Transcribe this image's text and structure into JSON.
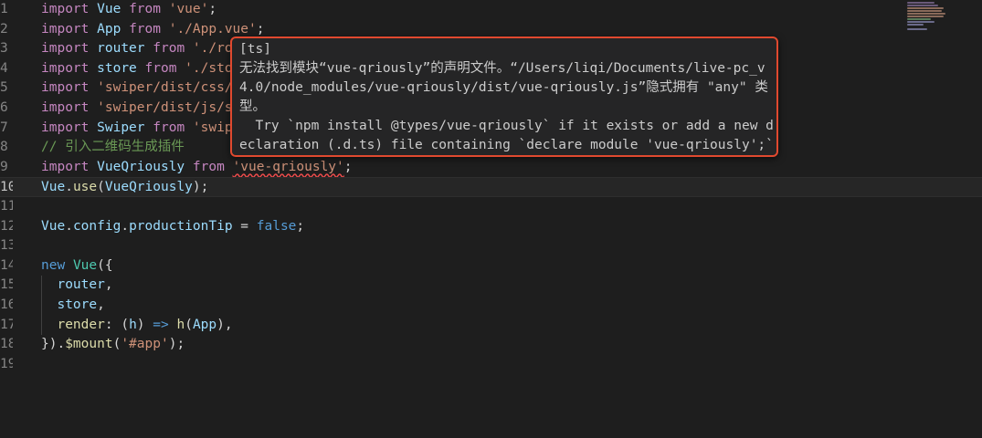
{
  "editor": {
    "lines": [
      {
        "num": "1",
        "tokens": [
          {
            "t": "import",
            "c": "kw2"
          },
          {
            "t": " "
          },
          {
            "t": "Vue",
            "c": "id"
          },
          {
            "t": " "
          },
          {
            "t": "from",
            "c": "kw2"
          },
          {
            "t": " "
          },
          {
            "t": "'vue'",
            "c": "str"
          },
          {
            "t": ";"
          }
        ]
      },
      {
        "num": "2",
        "tokens": [
          {
            "t": "import",
            "c": "kw2"
          },
          {
            "t": " "
          },
          {
            "t": "App",
            "c": "id"
          },
          {
            "t": " "
          },
          {
            "t": "from",
            "c": "kw2"
          },
          {
            "t": " "
          },
          {
            "t": "'./App.vue'",
            "c": "str"
          },
          {
            "t": ";"
          }
        ]
      },
      {
        "num": "3",
        "tokens": [
          {
            "t": "import",
            "c": "kw2"
          },
          {
            "t": " "
          },
          {
            "t": "router",
            "c": "id"
          },
          {
            "t": " "
          },
          {
            "t": "from",
            "c": "kw2"
          },
          {
            "t": " "
          },
          {
            "t": "'./ro",
            "c": "str"
          }
        ]
      },
      {
        "num": "4",
        "tokens": [
          {
            "t": "import",
            "c": "kw2"
          },
          {
            "t": " "
          },
          {
            "t": "store",
            "c": "id"
          },
          {
            "t": " "
          },
          {
            "t": "from",
            "c": "kw2"
          },
          {
            "t": " "
          },
          {
            "t": "'./sto",
            "c": "str"
          }
        ]
      },
      {
        "num": "5",
        "tokens": [
          {
            "t": "import",
            "c": "kw2"
          },
          {
            "t": " "
          },
          {
            "t": "'swiper/dist/css/",
            "c": "str"
          }
        ]
      },
      {
        "num": "6",
        "tokens": [
          {
            "t": "import",
            "c": "kw2"
          },
          {
            "t": " "
          },
          {
            "t": "'swiper/dist/js/s",
            "c": "str"
          }
        ]
      },
      {
        "num": "7",
        "tokens": [
          {
            "t": "import",
            "c": "kw2"
          },
          {
            "t": " "
          },
          {
            "t": "Swiper",
            "c": "id"
          },
          {
            "t": " "
          },
          {
            "t": "from",
            "c": "kw2"
          },
          {
            "t": " "
          },
          {
            "t": "'swip",
            "c": "str"
          }
        ]
      },
      {
        "num": "8",
        "tokens": [
          {
            "t": "// 引入二维码生成插件",
            "c": "cmt"
          }
        ]
      },
      {
        "num": "9",
        "tokens": [
          {
            "t": "import",
            "c": "kw2"
          },
          {
            "t": " "
          },
          {
            "t": "VueQriously",
            "c": "id"
          },
          {
            "t": " "
          },
          {
            "t": "from",
            "c": "kw2"
          },
          {
            "t": " "
          },
          {
            "t": "'vue-qriously'",
            "c": "str squiggle"
          },
          {
            "t": ";"
          }
        ]
      },
      {
        "num": "10",
        "current": true,
        "tokens": [
          {
            "t": "Vue",
            "c": "id"
          },
          {
            "t": "."
          },
          {
            "t": "use",
            "c": "fn"
          },
          {
            "t": "("
          },
          {
            "t": "VueQriously",
            "c": "id"
          },
          {
            "t": ");"
          }
        ]
      },
      {
        "num": "11",
        "tokens": []
      },
      {
        "num": "12",
        "tokens": [
          {
            "t": "Vue",
            "c": "id"
          },
          {
            "t": "."
          },
          {
            "t": "config",
            "c": "prop"
          },
          {
            "t": "."
          },
          {
            "t": "productionTip",
            "c": "prop"
          },
          {
            "t": " = "
          },
          {
            "t": "false",
            "c": "kw"
          },
          {
            "t": ";"
          }
        ]
      },
      {
        "num": "13",
        "tokens": []
      },
      {
        "num": "14",
        "tokens": [
          {
            "t": "new",
            "c": "kw"
          },
          {
            "t": " "
          },
          {
            "t": "Vue",
            "c": "cls"
          },
          {
            "t": "({"
          }
        ]
      },
      {
        "num": "15",
        "tokens": [
          {
            "t": "  "
          },
          {
            "t": "router",
            "c": "prop"
          },
          {
            "t": ","
          }
        ]
      },
      {
        "num": "16",
        "tokens": [
          {
            "t": "  "
          },
          {
            "t": "store",
            "c": "prop"
          },
          {
            "t": ","
          }
        ]
      },
      {
        "num": "17",
        "tokens": [
          {
            "t": "  "
          },
          {
            "t": "render",
            "c": "fn"
          },
          {
            "t": ": ("
          },
          {
            "t": "h",
            "c": "id"
          },
          {
            "t": ") "
          },
          {
            "t": "=>",
            "c": "kw"
          },
          {
            "t": " "
          },
          {
            "t": "h",
            "c": "fn"
          },
          {
            "t": "("
          },
          {
            "t": "App",
            "c": "id"
          },
          {
            "t": "),"
          }
        ]
      },
      {
        "num": "18",
        "tokens": [
          {
            "t": "})."
          },
          {
            "t": "$mount",
            "c": "fn"
          },
          {
            "t": "("
          },
          {
            "t": "'#app'",
            "c": "str"
          },
          {
            "t": ");"
          }
        ]
      },
      {
        "num": "19",
        "tokens": []
      }
    ]
  },
  "tooltip": {
    "lines": [
      "[ts]",
      "无法找到模块“vue-qriously”的声明文件。“/Users/liqi/Documents/live-pc_v",
      "4.0/node_modules/vue-qriously/dist/vue-qriously.js”隐式拥有 \"any\" 类",
      "型。",
      "  Try `npm install @types/vue-qriously` if it exists or add a new d",
      "eclaration (.d.ts) file containing `declare module 'vue-qriously';`"
    ],
    "border_color": "#e0492f"
  }
}
